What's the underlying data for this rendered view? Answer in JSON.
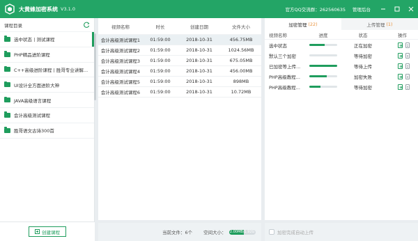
{
  "app": {
    "name": "大黄蜂加密系统",
    "version": "V3.1.0",
    "qq_label": "官方QQ交流群：262560635",
    "admin_label": "管理后台"
  },
  "colors": {
    "accent": "#1f9d5d",
    "titlebar": "#23a566",
    "badge": "#e8913a"
  },
  "left": {
    "title": "课程目录",
    "refresh_icon": "refresh-icon",
    "courses": [
      "选中状态丨测试课程",
      "PHP精品进阶课程",
      "C++高级进阶课程丨胜哥专业讲解...",
      "UI设计全方面进阶大神",
      "JAVA高级语言课程",
      "会计高级测试课程",
      "胜哥语文古诗300首"
    ],
    "create_label": "创建课程"
  },
  "files": {
    "headers": [
      "视频名称",
      "时长",
      "创建日期",
      "文件大小"
    ],
    "rows": [
      [
        "会计高级测试课程1",
        "01:59:00",
        "2018-10-31",
        "456.75MB"
      ],
      [
        "会计高级测试课程2",
        "01:59:00",
        "2018-10-31",
        "1024.56MB"
      ],
      [
        "会计高级测试课程3",
        "01:59:00",
        "2018-10-31",
        "675.05MB"
      ],
      [
        "会计高级测试课程4",
        "01:59:00",
        "2018-10-31",
        "456.00MB"
      ],
      [
        "会计高级测试课程5",
        "01:59:00",
        "2018-10-31",
        "898MB"
      ],
      [
        "会计高级测试课程6",
        "01:59:00",
        "2018-10-31",
        "10.72MB"
      ]
    ],
    "footer": {
      "count_label": "当前文件：6个",
      "space_label": "空间大小：",
      "space_value": "2.00MB/1.92G",
      "space_fraction": 0.55
    }
  },
  "right": {
    "tab_encrypt": "加密管理",
    "tab_encrypt_count": "(22)",
    "tab_upload": "上传管理",
    "tab_upload_count": "(1)",
    "headers": [
      "视频名称",
      "进度",
      "状态",
      "操作"
    ],
    "tasks": [
      {
        "name": "选中状态",
        "progress": 0.55,
        "status": "正在加密"
      },
      {
        "name": "默认三个加密",
        "progress": 0,
        "status": "等待加密"
      },
      {
        "name": "已加密等上传...",
        "progress": 1.0,
        "status": "等待上传"
      },
      {
        "name": "PHP高级教程...",
        "progress": 0.62,
        "status": "加密失败"
      },
      {
        "name": "PHP高级教程...",
        "progress": 0.4,
        "status": "等待加密"
      }
    ],
    "footer_label": "加密完成自动上传"
  }
}
